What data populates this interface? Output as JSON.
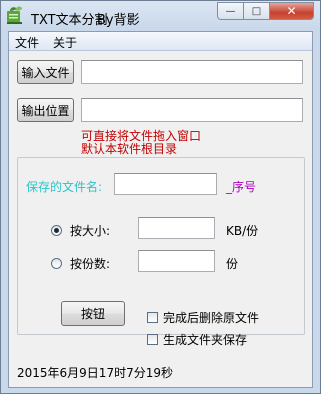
{
  "window": {
    "title": "TXT文本分割",
    "title_by": "By背影",
    "min_glyph": "—",
    "max_glyph": "□",
    "close_glyph": "✕"
  },
  "menu": {
    "items": [
      "文件",
      "关于"
    ]
  },
  "input_button": {
    "label": "输入文件"
  },
  "input_path": {
    "value": ""
  },
  "output_button": {
    "label": "输出位置"
  },
  "output_path": {
    "value": ""
  },
  "hint": {
    "line1": "可直接将文件拖入窗口",
    "line2": "默认本软件根目录"
  },
  "save_name": {
    "label": "保存的文件名:",
    "value": "",
    "suffix": "_序号"
  },
  "split_by_size": {
    "label": "按大小:",
    "value": "",
    "unit": "KB/份",
    "checked": true
  },
  "split_by_count": {
    "label": "按份数:",
    "value": "",
    "unit": "份",
    "checked": false
  },
  "action_button": {
    "label": "按钮"
  },
  "delete_source": {
    "label": "完成后删除原文件",
    "checked": false
  },
  "create_folder": {
    "label": "生成文件夹保存",
    "checked": false
  },
  "status": {
    "text": "2015年6月9日17时7分19秒"
  },
  "colors": {
    "save_label": "#27c6c8",
    "suffix": "#b000c0",
    "hint": "#c00000",
    "close_button": "#c4422f"
  },
  "icons": {
    "app": "leaf-book-icon"
  }
}
